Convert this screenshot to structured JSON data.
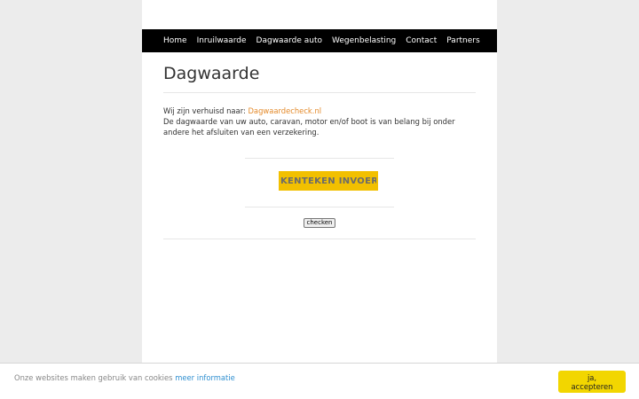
{
  "nav": {
    "items": [
      {
        "label": "Home"
      },
      {
        "label": "Inruilwaarde"
      },
      {
        "label": "Dagwaarde auto"
      },
      {
        "label": "Wegenbelasting"
      },
      {
        "label": "Contact"
      },
      {
        "label": "Partners"
      }
    ]
  },
  "main": {
    "title": "Dagwaarde",
    "moved_prefix": "Wij zijn verhuisd naar: ",
    "moved_link": "Dagwaardecheck.nl",
    "description": "De dagwaarde van uw auto, caravan, motor en/of boot is van belang bij onder andere het afsluiten van een verzekering."
  },
  "form": {
    "plate_placeholder": "KENTEKEN INVOEREN",
    "plate_value": "",
    "submit_label": "checken"
  },
  "cookie": {
    "text": "Onze websites maken gebruik van cookies ",
    "link": "meer informatie",
    "accept_label": "ja, accepteren"
  },
  "colors": {
    "nav_background": "#000000",
    "link": "#e48a2a",
    "plate_background": "#f2c000",
    "accept_background": "#f2d600",
    "cookie_link": "#2f8fd0"
  }
}
